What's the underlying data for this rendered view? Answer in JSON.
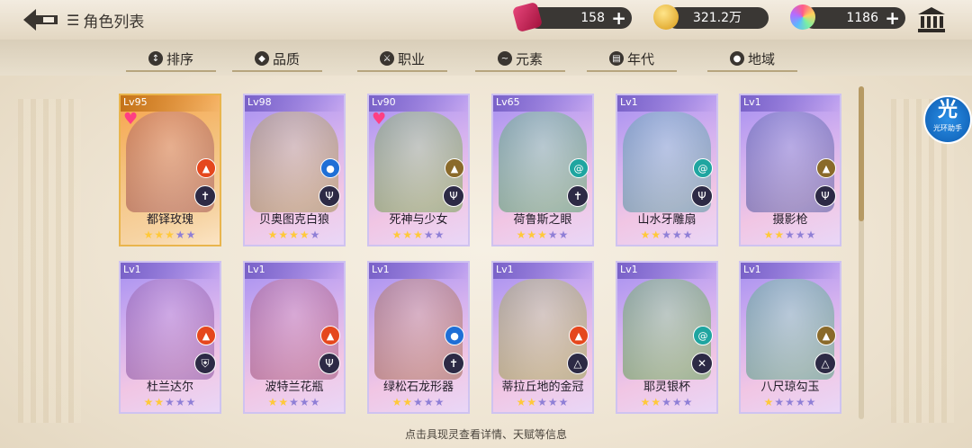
{
  "header": {
    "title": "角色列表"
  },
  "resources": [
    {
      "icon": "ticket-icon",
      "value": "158"
    },
    {
      "icon": "gold-coin-icon",
      "value": "321.2万"
    },
    {
      "icon": "rainbow-gem-icon",
      "value": "1186"
    }
  ],
  "filters": [
    {
      "label": "排序",
      "icon": "sort-icon"
    },
    {
      "label": "品质",
      "icon": "quality-icon"
    },
    {
      "label": "职业",
      "icon": "class-icon"
    },
    {
      "label": "元素",
      "icon": "element-icon"
    },
    {
      "label": "年代",
      "icon": "era-icon"
    },
    {
      "label": "地域",
      "icon": "location-pin-icon"
    }
  ],
  "cards": [
    {
      "lv": "Lv95",
      "name": "都铎玫瑰",
      "stars": 3,
      "element": "fire",
      "cls": "sword",
      "heart": true,
      "gold": true
    },
    {
      "lv": "Lv98",
      "name": "贝奥图克白狼",
      "stars": 4,
      "element": "water",
      "cls": "trident",
      "heart": false,
      "gold": false
    },
    {
      "lv": "Lv90",
      "name": "死神与少女",
      "stars": 3,
      "element": "earth",
      "cls": "trident",
      "heart": true,
      "gold": false
    },
    {
      "lv": "Lv65",
      "name": "荷鲁斯之眼",
      "stars": 3,
      "element": "wind",
      "cls": "sword",
      "heart": false,
      "gold": false
    },
    {
      "lv": "Lv1",
      "name": "山水牙雕扇",
      "stars": 2,
      "element": "wind",
      "cls": "trident",
      "heart": false,
      "gold": false
    },
    {
      "lv": "Lv1",
      "name": "摄影枪",
      "stars": 2,
      "element": "earth",
      "cls": "trident",
      "heart": false,
      "gold": false
    },
    {
      "lv": "Lv1",
      "name": "杜兰达尔",
      "stars": 2,
      "element": "fire",
      "cls": "shield",
      "heart": false,
      "gold": false
    },
    {
      "lv": "Lv1",
      "name": "波特兰花瓶",
      "stars": 2,
      "element": "fire",
      "cls": "trident",
      "heart": false,
      "gold": false
    },
    {
      "lv": "Lv1",
      "name": "绿松石龙形器",
      "stars": 2,
      "element": "water",
      "cls": "sword",
      "heart": false,
      "gold": false
    },
    {
      "lv": "Lv1",
      "name": "蒂拉丘地的金冠",
      "stars": 2,
      "element": "fire",
      "cls": "triangle",
      "heart": false,
      "gold": false
    },
    {
      "lv": "Lv1",
      "name": "耶灵银杯",
      "stars": 2,
      "element": "wind",
      "cls": "cross-swords",
      "heart": false,
      "gold": false
    },
    {
      "lv": "Lv1",
      "name": "八尺琼勾玉",
      "stars": 1,
      "element": "earth",
      "cls": "triangle",
      "heart": false,
      "gold": false
    }
  ],
  "colors": {
    "fire": "#e5471d",
    "water": "#1f6fd6",
    "earth": "#8a6a2a",
    "wind": "#1fa5a0",
    "accent_star": "#ffc93a"
  },
  "side_badge": {
    "big": "光",
    "small": "光环助手"
  },
  "hint": "点击具现灵查看详情、天赋等信息"
}
